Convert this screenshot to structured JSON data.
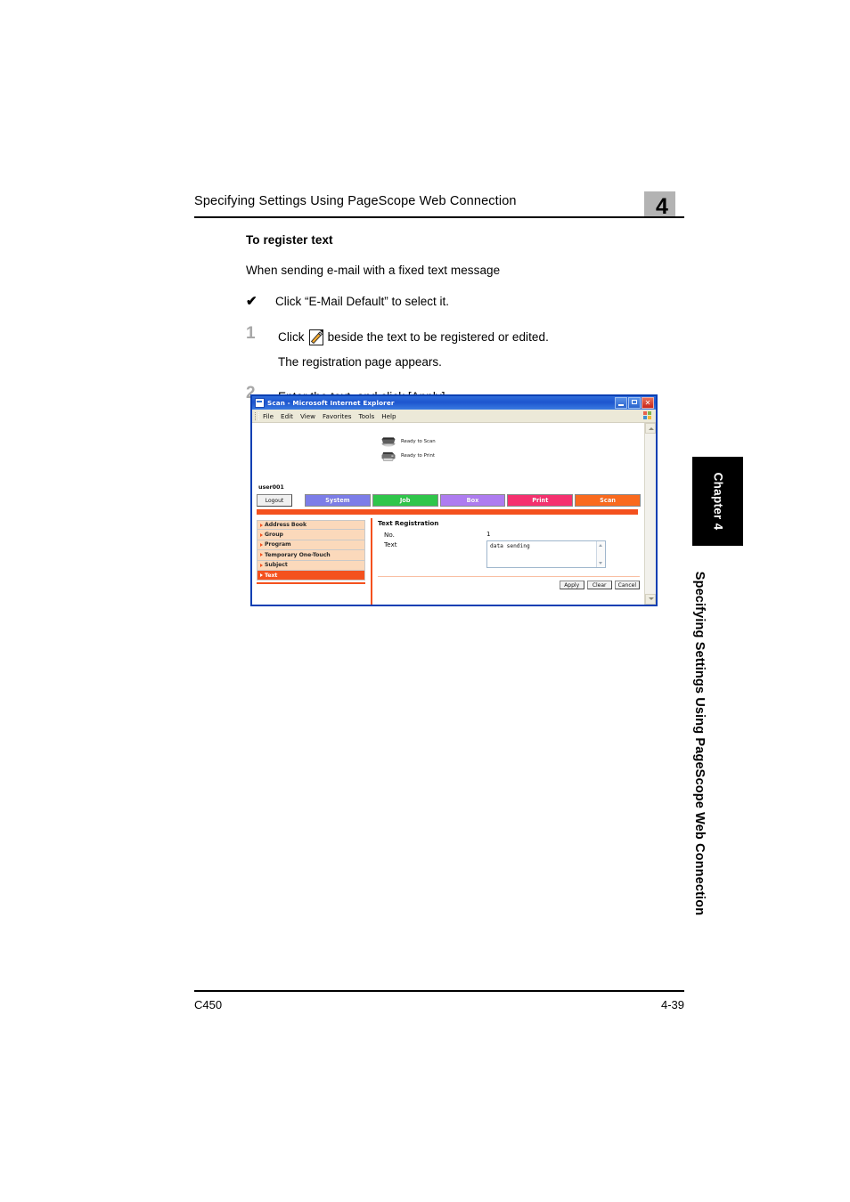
{
  "header": {
    "title": "Specifying Settings Using PageScope Web Connection",
    "chapter_number": "4"
  },
  "body": {
    "sub_head": "To register text",
    "intro": "When sending e-mail with a fixed text message",
    "check_item": "Click “E-Mail Default” to select it.",
    "check_mark": "✔",
    "steps": [
      {
        "num": "1",
        "text_before": "Click",
        "icon": "edit-pencil-icon",
        "text_after": "beside the text to be registered or edited.",
        "sub": "The registration page appears."
      },
      {
        "num": "2",
        "text": "Enter the text, and click [Apply]."
      }
    ]
  },
  "screenshot": {
    "window": {
      "title": "Scan - Microsoft Internet Explorer",
      "buttons": {
        "minimize": "minimize-button",
        "maximize": "maximize-button",
        "close": "✕"
      },
      "menu": [
        "File",
        "Edit",
        "View",
        "Favorites",
        "Tools",
        "Help"
      ]
    },
    "status": [
      {
        "label": "Ready to Scan",
        "icon": "scanner-icon"
      },
      {
        "label": "Ready to Print",
        "icon": "printer-icon"
      }
    ],
    "user": "user001",
    "logout_label": "Logout",
    "nav_tabs": [
      {
        "label": "System",
        "color": "#7c7de8"
      },
      {
        "label": "Job",
        "color": "#2fc64a"
      },
      {
        "label": "Box",
        "color": "#ae7cf0"
      },
      {
        "label": "Print",
        "color": "#f5316f"
      },
      {
        "label": "Scan",
        "color": "#fa6a1e"
      }
    ],
    "accent_color": "#f4511e",
    "sidebar": [
      {
        "label": "Address Book",
        "active": false
      },
      {
        "label": "Group",
        "active": false
      },
      {
        "label": "Program",
        "active": false
      },
      {
        "label": "Temporary One-Touch",
        "active": false
      },
      {
        "label": "Subject",
        "active": false
      },
      {
        "label": "Text",
        "active": true
      }
    ],
    "form": {
      "title": "Text Registration",
      "no_label": "No.",
      "no_value": "1",
      "text_label": "Text",
      "text_value": "data sending",
      "buttons": [
        "Apply",
        "Clear",
        "Cancel"
      ]
    }
  },
  "tab": {
    "chapter_label": "Chapter 4"
  },
  "side_text": "Specifying Settings Using PageScope Web Connection",
  "footer": {
    "model": "C450",
    "page": "4-39"
  }
}
